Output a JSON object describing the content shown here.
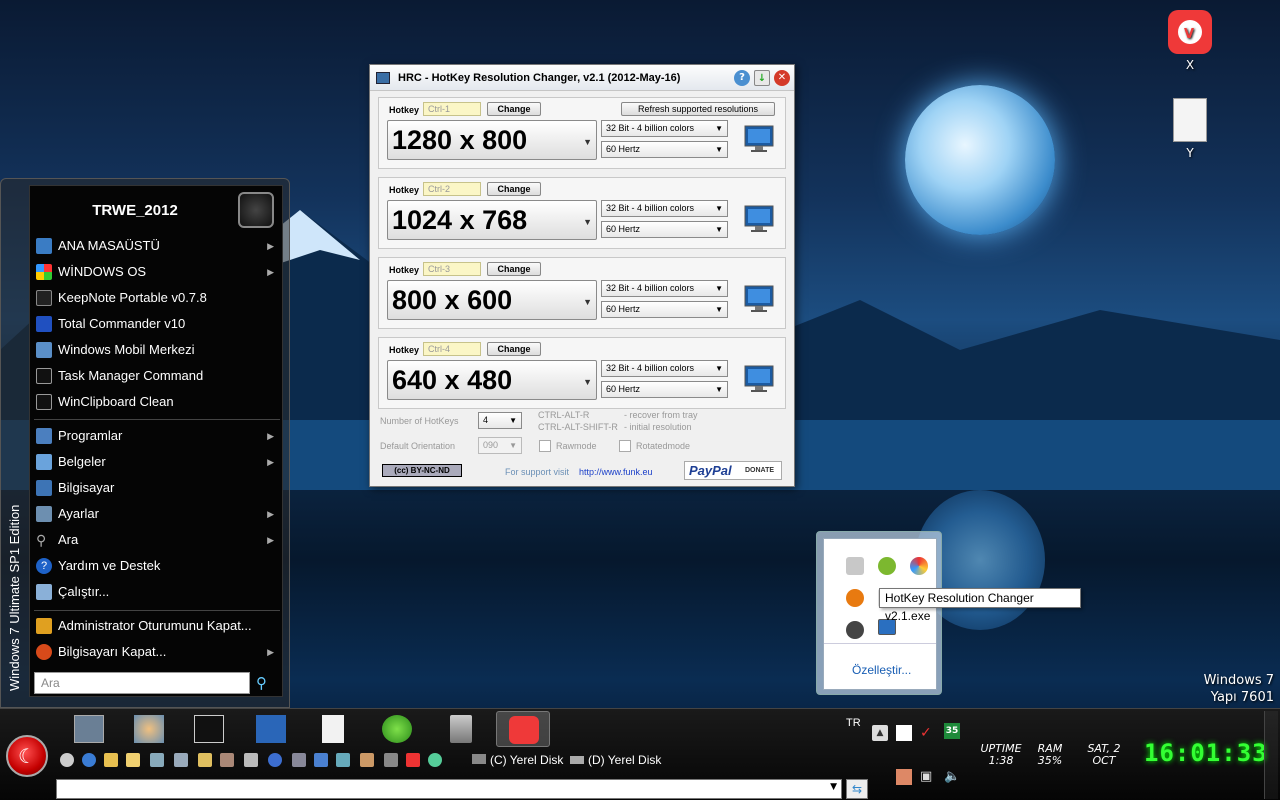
{
  "desktop": {
    "icons": [
      {
        "label": "X",
        "icon": "vivaldi-icon"
      },
      {
        "label": "Y",
        "icon": "document-icon"
      }
    ],
    "brand_line1": "Windows 7",
    "brand_line2": "Yapı 7601"
  },
  "hrc": {
    "title": "HRC - HotKey Resolution Changer, v2.1 (2012-May-16)",
    "refresh_label": "Refresh supported resolutions",
    "hotkey_label": "Hotkey",
    "change_label": "Change",
    "rows": [
      {
        "key": "Ctrl-1",
        "resolution": "1280 x 800",
        "depth": "32 Bit - 4 billion colors",
        "freq": "60 Hertz"
      },
      {
        "key": "Ctrl-2",
        "resolution": "1024 x 768",
        "depth": "32 Bit - 4 billion colors",
        "freq": "60 Hertz"
      },
      {
        "key": "Ctrl-3",
        "resolution": "800 x 600",
        "depth": "32 Bit - 4 billion colors",
        "freq": "60 Hertz"
      },
      {
        "key": "Ctrl-4",
        "resolution": "640 x 480",
        "depth": "32 Bit - 4 billion colors",
        "freq": "60 Hertz"
      }
    ],
    "num_hotkeys_label": "Number of HotKeys",
    "num_hotkeys_value": "4",
    "orientation_label": "Default Orientation",
    "orientation_value": "090",
    "shortcut1_key": "CTRL-ALT-R",
    "shortcut1_desc": "- recover from tray",
    "shortcut2_key": "CTRL-ALT-SHIFT-R",
    "shortcut2_desc": "- initial resolution",
    "rawmode_label": "Rawmode",
    "rotatedmode_label": "Rotatedmode",
    "license_label": "(cc) BY-NC-ND",
    "support_label": "For support visit",
    "support_url": "http://www.funk.eu",
    "paypal_label": "PayPal",
    "donate_label": "DONATE"
  },
  "start_menu": {
    "user": "TRWE_2012",
    "edition": "Windows 7 Ultimate SP1 Edition",
    "pinned": [
      {
        "label": "ANA MASAÜSTÜ",
        "submenu": true
      },
      {
        "label": "WİNDOWS OS",
        "submenu": true
      },
      {
        "label": "KeepNote Portable v0.7.8",
        "submenu": false
      },
      {
        "label": "Total Commander v10",
        "submenu": false
      },
      {
        "label": "Windows Mobil Merkezi",
        "submenu": false
      },
      {
        "label": "Task Manager Command",
        "submenu": false
      },
      {
        "label": "WinClipboard Clean",
        "submenu": false
      }
    ],
    "system": [
      {
        "label": "Programlar",
        "submenu": true
      },
      {
        "label": "Belgeler",
        "submenu": true
      },
      {
        "label": "Bilgisayar",
        "submenu": false
      },
      {
        "label": "Ayarlar",
        "submenu": true
      },
      {
        "label": "Ara",
        "submenu": true
      },
      {
        "label": "Yardım ve Destek",
        "submenu": false
      },
      {
        "label": "Çalıştır...",
        "submenu": false
      }
    ],
    "power": [
      {
        "label": "Administrator Oturumunu Kapat...",
        "submenu": false
      },
      {
        "label": "Bilgisayarı Kapat...",
        "submenu": true
      }
    ],
    "search_placeholder": "Ara"
  },
  "tray_popup": {
    "customize_label": "Özelleştir...",
    "tooltip": "HotKey Resolution Changer v2.1.exe"
  },
  "taskbar": {
    "drives": [
      "(C) Yerel Disk",
      "(D) Yerel Disk"
    ],
    "lang": "TR",
    "tray_badge": "35",
    "uptime_label": "UPTIME",
    "uptime_value": "1:38",
    "ram_label": "RAM",
    "ram_value": "35%",
    "day_label": "SAT, 2",
    "month_label": "OCT",
    "clock": "16:01:33"
  },
  "colors": {
    "accent": "#1e5aa8",
    "clock": "#33ff33",
    "vivaldi": "#ef3939"
  }
}
